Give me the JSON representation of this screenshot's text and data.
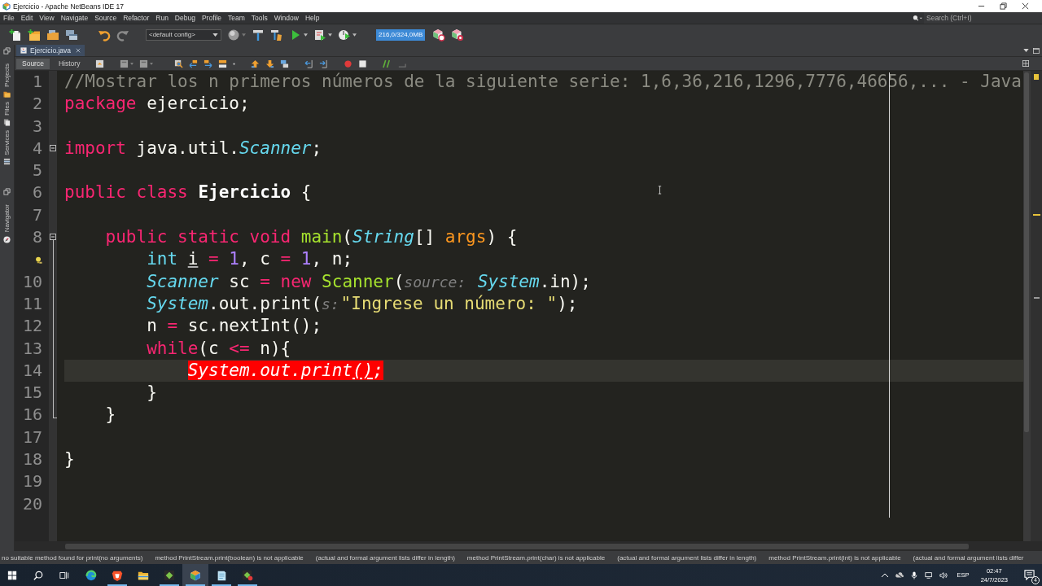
{
  "window": {
    "title": "Ejercicio - Apache NetBeans IDE 17"
  },
  "menu_bar": [
    "File",
    "Edit",
    "View",
    "Navigate",
    "Source",
    "Refactor",
    "Run",
    "Debug",
    "Profile",
    "Team",
    "Tools",
    "Window",
    "Help"
  ],
  "search": {
    "placeholder": "Search (Ctrl+I)"
  },
  "toolbar": {
    "config_dropdown": "<default config>",
    "memory_indicator": "216,0/324,0MB"
  },
  "side_bar": {
    "upper_tabs": [
      "Projects",
      "Files",
      "Services"
    ],
    "lower_tabs": [
      "Navigator"
    ]
  },
  "editor_tabs": [
    {
      "label": "Ejercicio.java",
      "selected": true
    }
  ],
  "editor_views": [
    {
      "label": "Source",
      "selected": true
    },
    {
      "label": "History",
      "selected": false
    }
  ],
  "code_lines": [
    {
      "kind": "code",
      "number": "1",
      "current": false,
      "tokens": [
        {
          "kind": "comment",
          "text": "//Mostrar los n primeros números de la siguiente serie: 1,6,36,216,1296,7776,46656,... - Java"
        }
      ]
    },
    {
      "kind": "code",
      "number": "2",
      "current": false,
      "tokens": [
        {
          "kind": "keyword",
          "text": "package "
        },
        {
          "kind": "plain",
          "text": "ejercicio;"
        }
      ]
    },
    {
      "kind": "code",
      "number": "3",
      "current": false
    },
    {
      "kind": "fold",
      "number": "4",
      "current": false,
      "tokens": [
        {
          "kind": "keyword",
          "text": "import "
        },
        {
          "kind": "plain",
          "text": "java.util."
        },
        {
          "kind": "type",
          "text": "Scanner"
        },
        {
          "kind": "plain",
          "text": ";"
        }
      ]
    },
    {
      "kind": "code",
      "number": "5",
      "current": false
    },
    {
      "kind": "code",
      "number": "6",
      "current": false,
      "tokens": [
        {
          "kind": "keyword",
          "text": "public class "
        },
        {
          "kind": "class",
          "text": "Ejercicio"
        },
        {
          "kind": "plain",
          "text": " {"
        }
      ],
      "children": [
        {
          "kind": "code",
          "number": "7",
          "current": false
        },
        {
          "kind": "fold",
          "number": "8",
          "current": false,
          "tokens": [
            {
              "kind": "keyword",
              "text": "public static void "
            },
            {
              "kind": "method",
              "text": "main"
            },
            {
              "kind": "plain",
              "text": "("
            },
            {
              "kind": "type",
              "text": "String"
            },
            {
              "kind": "plain",
              "text": "[] "
            },
            {
              "kind": "param",
              "text": "args"
            },
            {
              "kind": "plain",
              "text": ") {"
            }
          ],
          "children": [
            {
              "kind": "hint",
              "current": false,
              "tokens": [
                {
                  "kind": "primitive",
                  "text": "int "
                },
                {
                  "kind": "unused",
                  "text": "i"
                },
                {
                  "kind": "keyword",
                  "text": " = "
                },
                {
                  "kind": "number",
                  "text": "1"
                },
                {
                  "kind": "plain",
                  "text": ", c"
                },
                {
                  "kind": "keyword",
                  "text": " = "
                },
                {
                  "kind": "number",
                  "text": "1"
                },
                {
                  "kind": "plain",
                  "text": ", n;"
                }
              ]
            },
            {
              "kind": "code",
              "number": "10",
              "current": false,
              "tokens": [
                {
                  "kind": "type",
                  "text": "Scanner"
                },
                {
                  "kind": "plain",
                  "text": " sc"
                },
                {
                  "kind": "keyword",
                  "text": " = new "
                },
                {
                  "kind": "method",
                  "text": "Scanner"
                },
                {
                  "kind": "plain",
                  "text": "("
                },
                {
                  "kind": "hint",
                  "text": "source:"
                },
                {
                  "kind": "type",
                  "text": " System"
                },
                {
                  "kind": "plain",
                  "text": ".in);"
                }
              ]
            },
            {
              "kind": "code",
              "number": "11",
              "current": false,
              "tokens": [
                {
                  "kind": "type",
                  "text": "System"
                },
                {
                  "kind": "plain",
                  "text": ".out.print("
                },
                {
                  "kind": "hint",
                  "text": "s:"
                },
                {
                  "kind": "string",
                  "text": "\"Ingrese un número: \""
                },
                {
                  "kind": "plain",
                  "text": ");"
                }
              ]
            },
            {
              "kind": "code",
              "number": "12",
              "current": false,
              "tokens": [
                {
                  "kind": "plain",
                  "text": "n"
                },
                {
                  "kind": "keyword",
                  "text": " = "
                },
                {
                  "kind": "plain",
                  "text": "sc.nextInt();"
                }
              ]
            },
            {
              "kind": "code",
              "number": "13",
              "current": false,
              "tokens": [
                {
                  "kind": "keyword",
                  "text": "while"
                },
                {
                  "kind": "plain",
                  "text": "(c"
                },
                {
                  "kind": "keyword",
                  "text": " <= "
                },
                {
                  "kind": "plain",
                  "text": "n){"
                }
              ],
              "children": [
                {
                  "kind": "code",
                  "number": "14",
                  "current": true,
                  "tokens": [
                    {
                      "kind": "error",
                      "text": "System.out.print"
                    },
                    {
                      "kind": "error-underlined",
                      "text": "()"
                    },
                    {
                      "kind": "error",
                      "text": ";"
                    }
                  ]
                }
              ]
            },
            {
              "kind": "code",
              "number": "15",
              "current": false,
              "tokens": [
                {
                  "kind": "plain",
                  "text": "}"
                }
              ]
            }
          ]
        },
        {
          "kind": "code",
          "number": "16",
          "current": false,
          "tokens": [
            {
              "kind": "plain",
              "text": "}"
            }
          ]
        },
        {
          "kind": "code",
          "number": "17",
          "current": false
        }
      ]
    },
    {
      "kind": "code",
      "number": "18",
      "current": false,
      "tokens": [
        {
          "kind": "plain",
          "text": "}"
        }
      ]
    },
    {
      "kind": "code",
      "number": "19",
      "current": false
    },
    {
      "kind": "code",
      "number": "20",
      "current": false
    }
  ],
  "status_bar": {
    "messages": [
      "no suitable method found for print(no arguments)",
      "method PrintStream.print(boolean) is not applicable",
      "(actual and formal argument lists differ in length)",
      "method PrintStream.print(char) is not applicable",
      "(actual and formal argument lists differ in length)",
      "method PrintStream.print(int) is not applicable",
      "(actual and formal argument lists differ"
    ]
  },
  "taskbar": {
    "apps": [
      {
        "running": false,
        "selected": false
      },
      {
        "running": true,
        "selected": false
      },
      {
        "running": false,
        "selected": false
      },
      {
        "running": true,
        "selected": false
      },
      {
        "running": true,
        "selected": true
      },
      {
        "running": true,
        "selected": false
      },
      {
        "running": true,
        "selected": false
      }
    ],
    "language": "ESP",
    "time": "02:47",
    "date": "24/7/2023",
    "notifications": "4"
  }
}
